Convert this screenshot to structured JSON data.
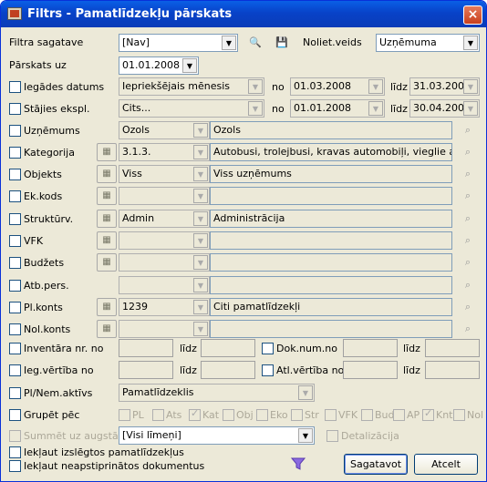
{
  "window": {
    "title": "Filtrs - Pamatlīdzekļu pārskats",
    "close_icon": "×"
  },
  "template": {
    "label": "Filtra sagatave",
    "value": "[Nav]",
    "nol_label": "Noliet.veids",
    "nol_value": "Uzņēmuma"
  },
  "overview": {
    "label": "Pārskats uz",
    "date": "01.01.2008"
  },
  "rows": {
    "iegades": {
      "label": "Iegādes datums",
      "period": "Iepriekšējais mēnesis",
      "no": "no",
      "from": "01.03.2008",
      "lidz": "līdz",
      "to": "31.03.2008"
    },
    "stajies": {
      "label": "Stājies ekspl.",
      "period": "Cits...",
      "no": "no",
      "from": "01.01.2008",
      "lidz": "līdz",
      "to": "30.04.2008"
    },
    "uznemums": {
      "label": "Uzņēmums",
      "code": "Ozols",
      "name": "Ozols"
    },
    "kategorija": {
      "label": "Kategorija",
      "code": "3.1.3.",
      "name": "Autobusi, trolejbusi, kravas automobiļi, vieglie a"
    },
    "objekts": {
      "label": "Objekts",
      "code": "Viss",
      "name": "Viss uzņēmums"
    },
    "ekkods": {
      "label": "Ek.kods",
      "code": "",
      "name": ""
    },
    "strukturv": {
      "label": "Struktūrv.",
      "code": "Admin",
      "name": "Administrācija"
    },
    "vfk": {
      "label": "VFK",
      "code": "",
      "name": ""
    },
    "budzets": {
      "label": "Budžets",
      "code": "",
      "name": ""
    },
    "atbpers": {
      "label": "Atb.pers.",
      "code": "",
      "name": ""
    },
    "plkonts": {
      "label": "Pl.konts",
      "code": "1239",
      "name": "Citi pamatlīdzekļi"
    },
    "nolkonts": {
      "label": "Nol.konts",
      "code": "",
      "name": ""
    }
  },
  "ranges": {
    "inventara": {
      "label": "Inventāra nr. no",
      "lidz": "līdz"
    },
    "dokum": {
      "label": "Dok.num.no",
      "lidz": "līdz"
    },
    "iegvert": {
      "label": "Ieg.vērtība no",
      "lidz": "līdz"
    },
    "atlvert": {
      "label": "Atl.vērtība no",
      "lidz": "līdz"
    }
  },
  "aktivs": {
    "label": "Pl/Nem.aktīvs",
    "value": "Pamatlīdzeklis"
  },
  "group": {
    "label": "Grupēt pēc",
    "items": [
      "PL",
      "Ats",
      "Kat",
      "Obj",
      "Eko",
      "Str",
      "VFK",
      "Bud",
      "AP",
      "Knt",
      "Nol"
    ]
  },
  "summet": {
    "label": "Summēt uz augstāko",
    "value": "[Visi līmeņi]",
    "detail": "Detalizācija"
  },
  "include1": "Iekļaut izslēgtos pamatlīdzekļus",
  "include2": "Iekļaut neapstiprinātos dokumentus",
  "buttons": {
    "ok": "Sagatavot",
    "cancel": "Atcelt"
  }
}
